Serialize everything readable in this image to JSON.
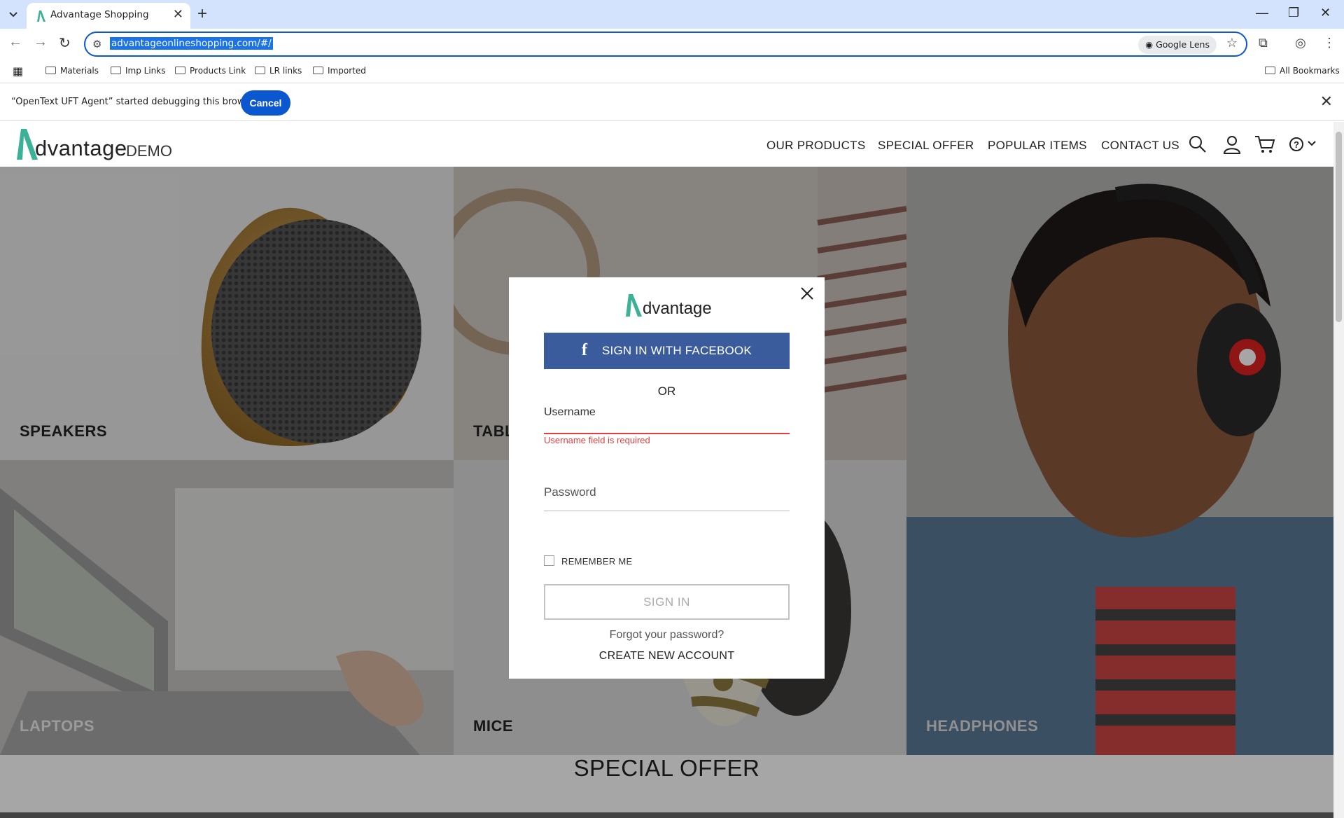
{
  "browser": {
    "tab_title": "Advantage Shopping",
    "url": "advantageonlineshopping.com/#/",
    "lens_label": "Google Lens",
    "bookmarks": [
      "Materials",
      "Imp Links",
      "Products Link",
      "LR links",
      "Imported"
    ],
    "all_bookmarks": "All Bookmarks",
    "infobar_message": "“OpenText UFT Agent” started debugging this browser",
    "infobar_cancel": "Cancel"
  },
  "site": {
    "logo_word": "dvantage",
    "logo_demo": "DEMO",
    "nav": [
      "OUR PRODUCTS",
      "SPECIAL OFFER",
      "POPULAR ITEMS",
      "CONTACT US"
    ],
    "accent": "#3bb197"
  },
  "tiles": {
    "speakers": "SPEAKERS",
    "tablets": "TABL",
    "headphones": "HEADPHONES",
    "laptops": "LAPTOPS",
    "mice": "MICE"
  },
  "special_offer": "SPECIAL OFFER",
  "modal": {
    "logo_word": "dvantage",
    "facebook_label": "SIGN IN WITH FACEBOOK",
    "or_label": "OR",
    "username_label": "Username",
    "username_error": "Username field is required",
    "password_label": "Password",
    "remember_label": "REMEMBER ME",
    "signin_label": "SIGN IN",
    "forgot_label": "Forgot your password?",
    "create_label": "CREATE NEW ACCOUNT",
    "facebook_color": "#3a5b9c",
    "error_color": "#e03f3f"
  }
}
